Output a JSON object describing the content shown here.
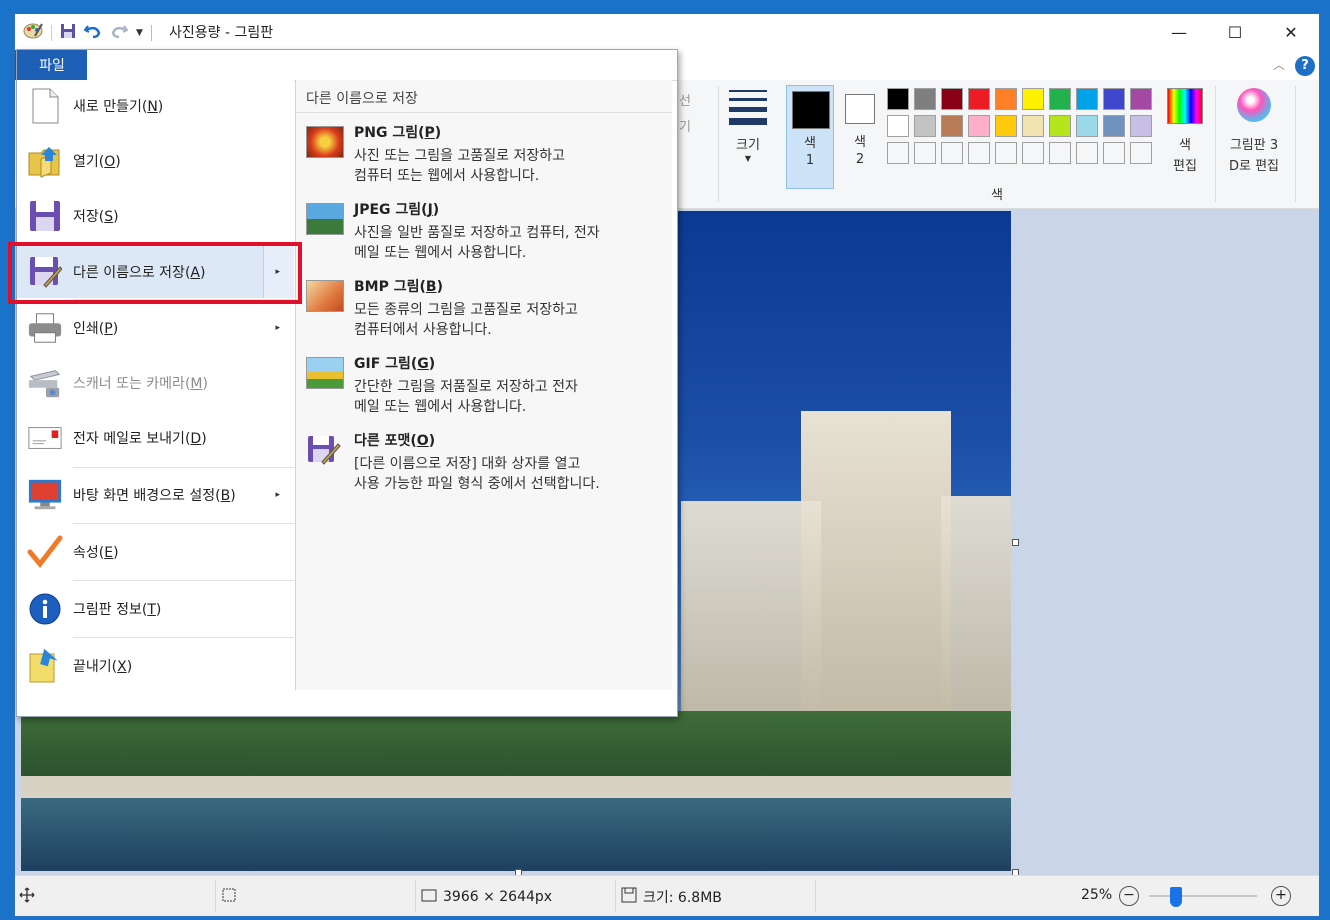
{
  "title_bar": {
    "title": "사진용량 - 그림판",
    "minimize": "—",
    "maximize": "☐",
    "close": "✕"
  },
  "ribbon": {
    "file_tab": "파일",
    "select_partial": "선",
    "crop_partial": "기",
    "size_label": "크기",
    "color1_label": "색\n1",
    "color1_line1": "색",
    "color1_line2": "1",
    "color2_line1": "색",
    "color2_line2": "2",
    "edit_colors_line1": "색",
    "edit_colors_line2": "편집",
    "paint3d_line1": "그림판 3",
    "paint3d_line2": "D로 편집",
    "colors_group": "색",
    "palette": [
      "#000000",
      "#7f7f7f",
      "#880015",
      "#ed1c24",
      "#ff7f27",
      "#fff200",
      "#22b14c",
      "#00a2e8",
      "#3f48cc",
      "#a349a4",
      "#ffffff",
      "#c3c3c3",
      "#b97a57",
      "#ffaec9",
      "#ffc90e",
      "#efe4b0",
      "#b5e61d",
      "#99d9ea",
      "#7092be",
      "#c8bfe7"
    ]
  },
  "file_menu": {
    "tab_label": "파일",
    "items": [
      {
        "label": "새로 만들기(",
        "key": "N",
        "icon": "new-file-icon"
      },
      {
        "label": "열기(",
        "key": "O",
        "icon": "open-folder-icon"
      },
      {
        "label": "저장(",
        "key": "S",
        "icon": "save-disk-icon"
      },
      {
        "label": "다른 이름으로 저장(",
        "key": "A",
        "icon": "save-as-icon"
      },
      {
        "label": "인쇄(",
        "key": "P",
        "icon": "printer-icon"
      },
      {
        "label": "스캐너 또는 카메라(",
        "key": "M",
        "icon": "scanner-icon"
      },
      {
        "label": "전자 메일로 보내기(",
        "key": "D",
        "icon": "email-icon"
      },
      {
        "label": "바탕 화면 배경으로 설정(",
        "key": "B",
        "icon": "desktop-background-icon"
      },
      {
        "label": "속성(",
        "key": "E",
        "icon": "properties-check-icon"
      },
      {
        "label": "그림판 정보(",
        "key": "T",
        "icon": "info-icon"
      },
      {
        "label": "끝내기(",
        "key": "X",
        "icon": "exit-icon"
      }
    ],
    "close_paren": ")",
    "submenu_arrow": "▸"
  },
  "save_as_panel": {
    "title": "다른 이름으로 저장",
    "formats": [
      {
        "name": "PNG 그림(",
        "key": "P",
        "desc_line1": "사진 또는 그림을 고품질로 저장하고",
        "desc_line2": "컴퓨터 또는 웹에서 사용합니다."
      },
      {
        "name": "JPEG 그림(",
        "key": "J",
        "desc_line1": "사진을 일반 품질로 저장하고 컴퓨터, 전자",
        "desc_line2": "메일 또는 웹에서 사용합니다."
      },
      {
        "name": "BMP 그림(",
        "key": "B",
        "desc_line1": "모든 종류의 그림을 고품질로 저장하고",
        "desc_line2": "컴퓨터에서 사용합니다."
      },
      {
        "name": "GIF 그림(",
        "key": "G",
        "desc_line1": "간단한 그림을 저품질로 저장하고 전자",
        "desc_line2": "메일 또는 웹에서 사용합니다."
      },
      {
        "name": "다른 포맷(",
        "key": "O",
        "desc_line1": "[다른 이름으로 저장] 대화 상자를 열고",
        "desc_line2": "사용 가능한 파일 형식 중에서 선택합니다."
      }
    ]
  },
  "status_bar": {
    "dimensions": "3966 × 2644px",
    "size": "크기: 6.8MB",
    "zoom": "25%",
    "zoom_level": 0.25
  }
}
